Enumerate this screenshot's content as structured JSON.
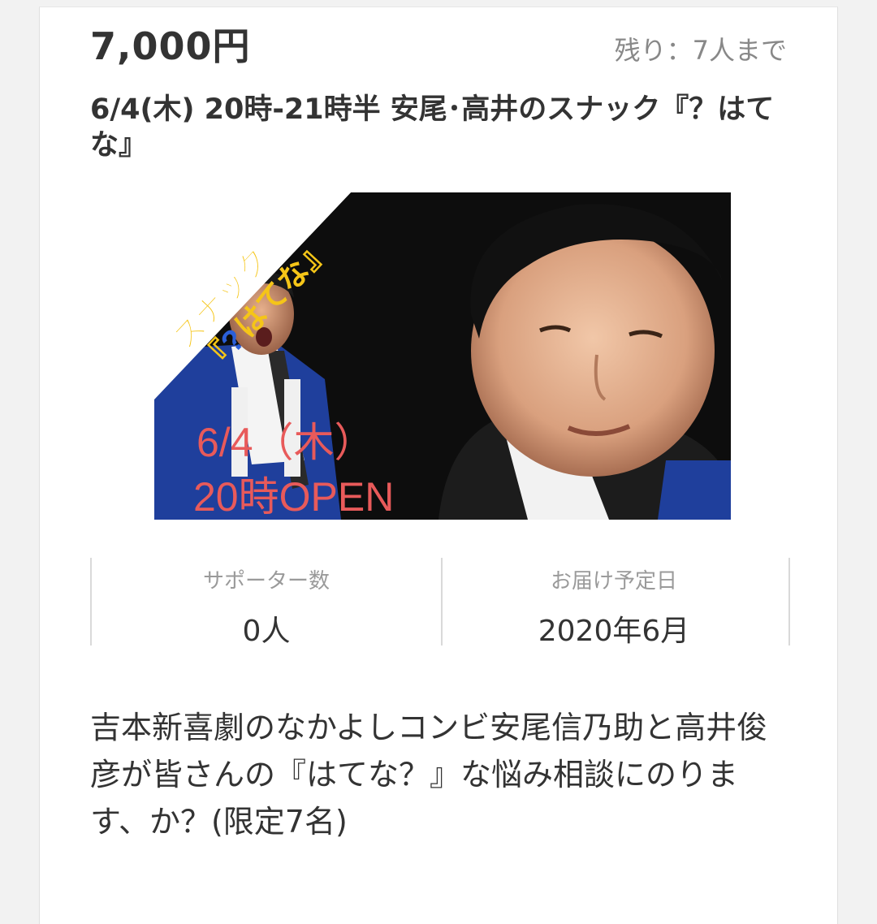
{
  "reward": {
    "price": "7,000円",
    "remaining": "残り：7人まで",
    "title": "6/4(木) 20時-21時半 安尾･高井のスナック『？はてな』",
    "image": {
      "banner_line1": "スナック",
      "banner_line2": "『",
      "banner_q": "?",
      "banner_line3": "はてな』",
      "date_text": "6/4（木）",
      "open_text": "20時OPEN",
      "colors": {
        "banner_text": "#f5c518",
        "question_mark": "#2b5fd9",
        "date_text": "#e85a5a",
        "background": "#0d0d0d"
      }
    },
    "stats": {
      "supporters_label": "サポーター数",
      "supporters_value": "0人",
      "delivery_label": "お届け予定日",
      "delivery_value": "2020年6月"
    },
    "description": "吉本新喜劇のなかよしコンビ安尾信乃助と高井俊彦が皆さんの『はてな？』な悩み相談にのります、か？(限定7名)"
  }
}
